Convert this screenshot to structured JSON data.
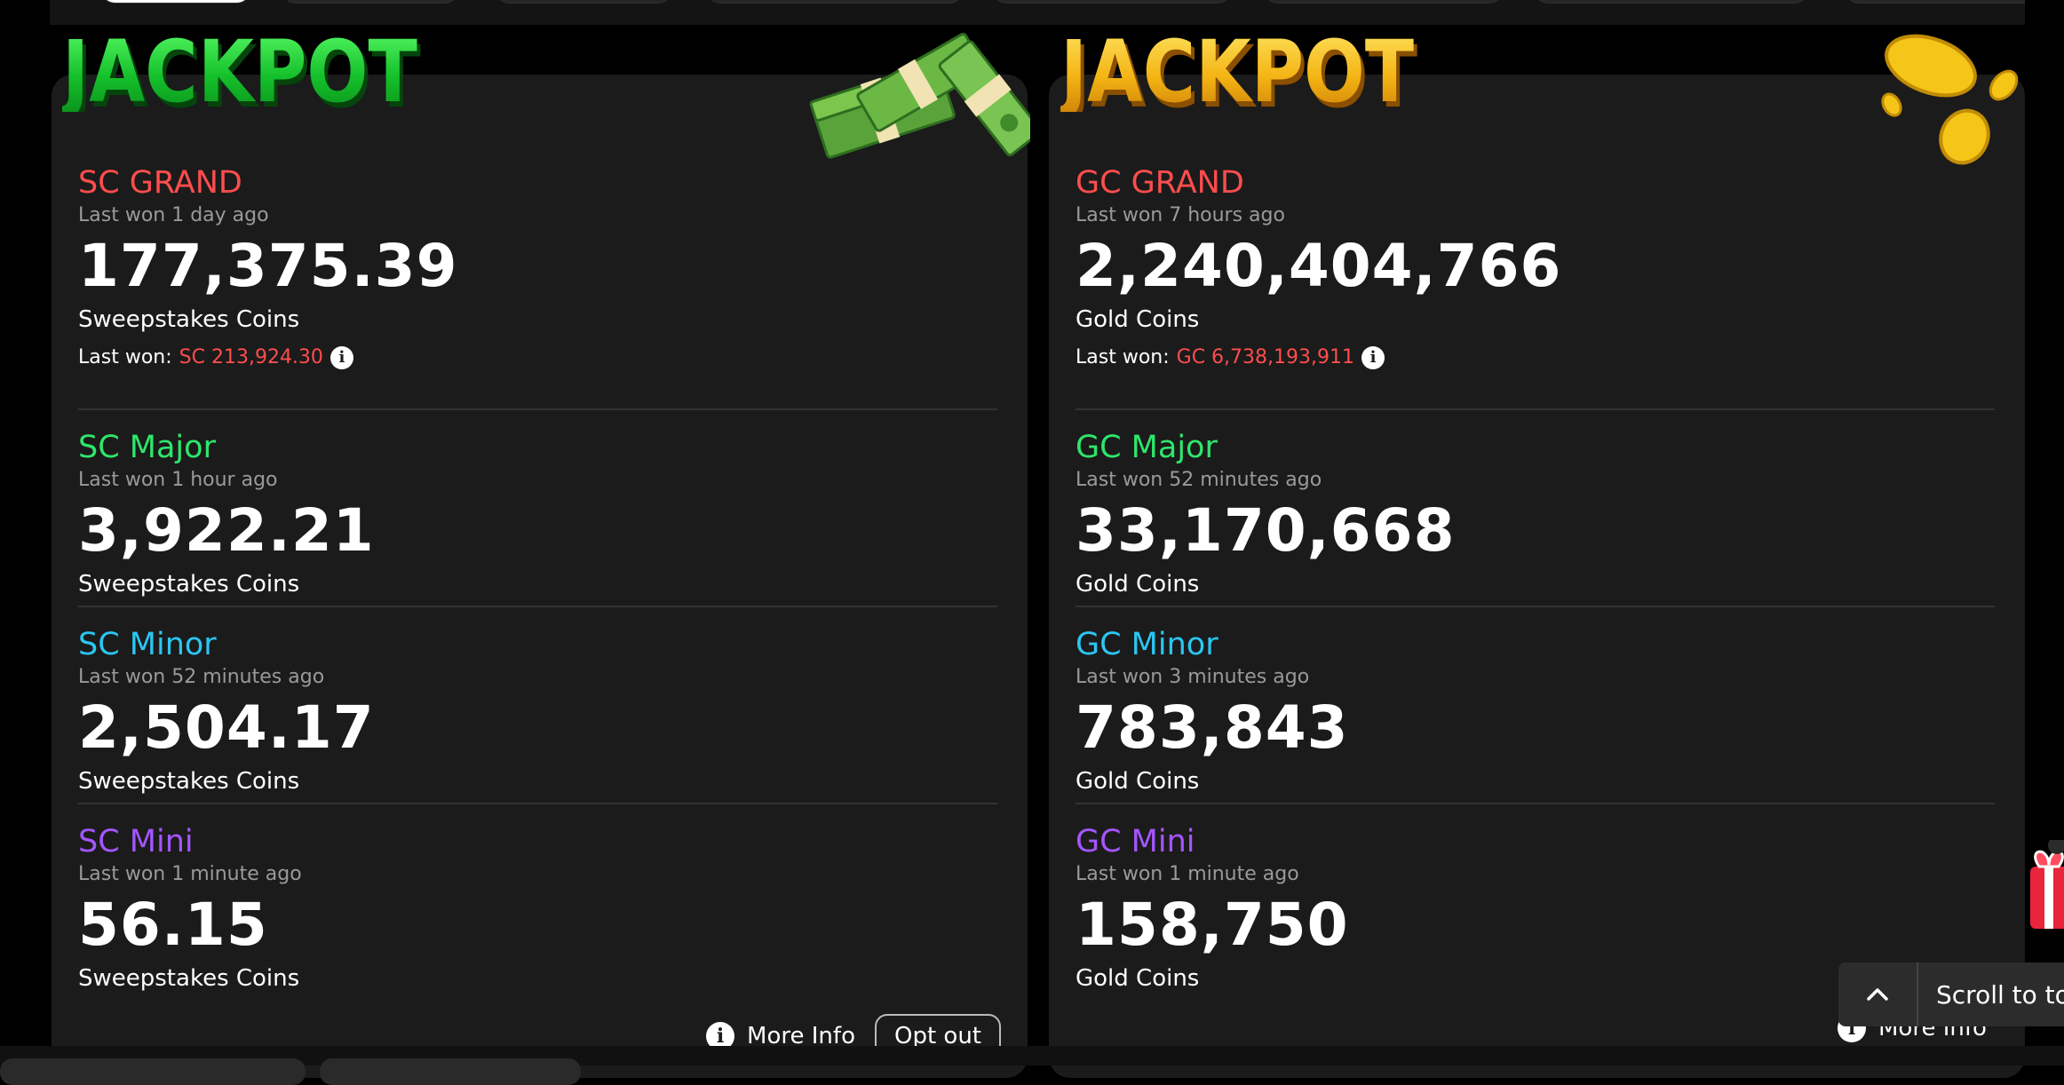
{
  "sc": {
    "logo_text": "JACKPOT",
    "tiers": [
      {
        "name": "SC GRAND",
        "when": "Last won 1 day ago",
        "amount": "177,375.39",
        "unit": "Sweepstakes Coins",
        "color": "#ff4d4d"
      },
      {
        "name": "SC Major",
        "when": "Last won 1 hour ago",
        "amount": "3,922.21",
        "unit": "Sweepstakes Coins",
        "color": "#2ee66b"
      },
      {
        "name": "SC Minor",
        "when": "Last won 52 minutes ago",
        "amount": "2,504.17",
        "unit": "Sweepstakes Coins",
        "color": "#2bc6f2"
      },
      {
        "name": "SC Mini",
        "when": "Last won 1 minute ago",
        "amount": "56.15",
        "unit": "Sweepstakes Coins",
        "color": "#a456ff"
      }
    ],
    "last_won_label": "Last won:",
    "last_won_value": "SC 213,924.30",
    "more_info": "More Info",
    "opt_out": "Opt out"
  },
  "gc": {
    "logo_text": "JACKPOT",
    "tiers": [
      {
        "name": "GC GRAND",
        "when": "Last won 7 hours ago",
        "amount": "2,240,404,766",
        "unit": "Gold Coins",
        "color": "#ff4d4d"
      },
      {
        "name": "GC Major",
        "when": "Last won 52 minutes ago",
        "amount": "33,170,668",
        "unit": "Gold Coins",
        "color": "#2ee66b"
      },
      {
        "name": "GC Minor",
        "when": "Last won 3 minutes ago",
        "amount": "783,843",
        "unit": "Gold Coins",
        "color": "#2bc6f2"
      },
      {
        "name": "GC Mini",
        "when": "Last won 1 minute ago",
        "amount": "158,750",
        "unit": "Gold Coins",
        "color": "#a456ff"
      }
    ],
    "last_won_label": "Last won:",
    "last_won_value": "GC 6,738,193,911",
    "more_info": "More Info"
  },
  "scroll_to_top": "Scroll to to",
  "icons": {
    "info": "info-icon",
    "chevron": "chevron-up-icon",
    "gift": "gift-icon",
    "cash": "cash-stack-icon",
    "coins": "gold-coins-icon"
  }
}
